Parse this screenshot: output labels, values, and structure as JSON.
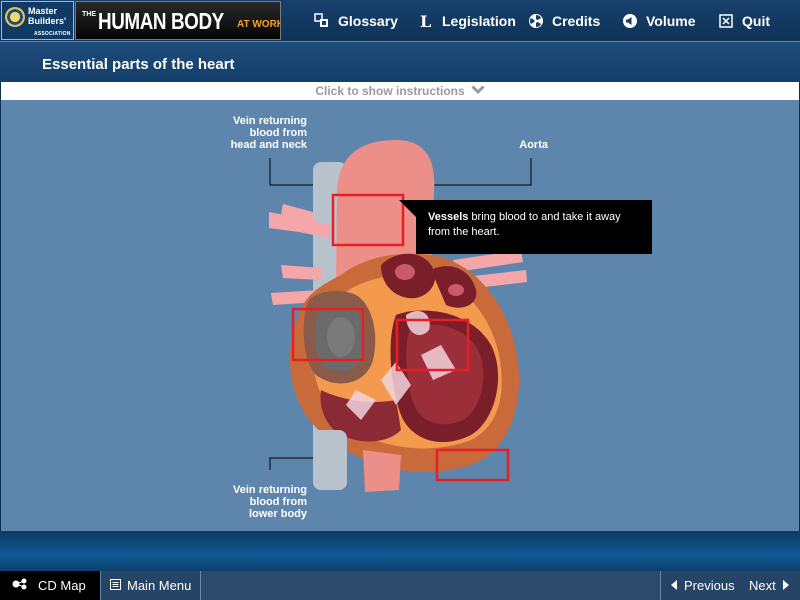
{
  "header": {
    "mb_logo": {
      "line1": "Master",
      "line2": "Builders'",
      "assoc": "ASSOCIATION"
    },
    "hb_logo": {
      "the_1": "THE",
      "title": "HUMAN BODY",
      "at_work": "AT WORK"
    },
    "nav": [
      {
        "label": "Glossary",
        "icon": "glossary-icon"
      },
      {
        "label": "Legislation",
        "icon": "legislation-icon"
      },
      {
        "label": "Credits",
        "icon": "credits-icon"
      },
      {
        "label": "Volume",
        "icon": "volume-icon"
      },
      {
        "label": "Quit",
        "icon": "quit-icon"
      }
    ]
  },
  "page": {
    "title": "Essential parts of the heart"
  },
  "instructions": {
    "label": "Click to show instructions"
  },
  "diagram": {
    "label_vein_head": [
      "Vein returning",
      "blood from",
      "head and neck"
    ],
    "label_aorta": "Aorta",
    "label_vein_lower": [
      "Vein returning",
      "blood from",
      "lower body"
    ],
    "tooltip": {
      "bold": "Vessels",
      "rest": " bring blood to and take it away from the heart."
    }
  },
  "footer": {
    "cd_map": "CD Map",
    "main_menu": "Main Menu",
    "previous": "Previous",
    "next": "Next"
  },
  "colors": {
    "hotspot": "#e81e24",
    "content_bg": "#5e86ad",
    "accent_orange": "#f0a12b"
  }
}
